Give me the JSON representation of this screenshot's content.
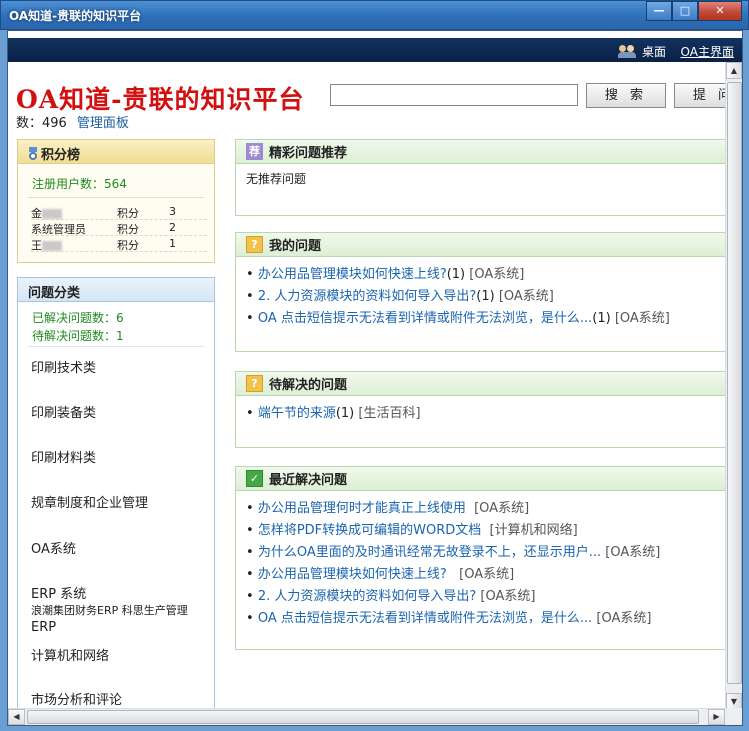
{
  "window": {
    "title": "OA知道-贵联的知识平台",
    "controls": {
      "minimize": "—",
      "maximize": "□",
      "close": "✕"
    }
  },
  "topbar": {
    "desktop": "桌面",
    "main": "OA主界面"
  },
  "header": {
    "site_title": "OA知道-贵联的知识平台",
    "search_value": "",
    "search_button": "搜 索",
    "ask_button": "提 问",
    "count_label": "数：496",
    "admin_link": "管理面板"
  },
  "score_board": {
    "title": "积分榜",
    "registered": "注册用户数：564",
    "rows": [
      {
        "name": "金",
        "label": "积分",
        "value": "3"
      },
      {
        "name": "系统管理员",
        "label": "积分",
        "value": "2"
      },
      {
        "name": "王",
        "label": "积分",
        "value": "1"
      }
    ]
  },
  "categories": {
    "title": "问题分类",
    "solved": "已解决问题数：6",
    "pending": "待解决问题数：1",
    "items": [
      "印刷技术类",
      "印刷装备类",
      "印刷材料类",
      "规章制度和企业管理",
      "OA系统",
      "ERP 系统",
      "浪潮集团财务ERP 科思生产管理",
      "ERP",
      "计算机和网络",
      "市场分析和评论"
    ]
  },
  "recommended": {
    "title": "精彩问题推荐",
    "empty": "无推荐问题",
    "icon": "荐"
  },
  "my_questions": {
    "title": "我的问题",
    "items": [
      {
        "text": "办公用品管理模块如何快速上线?",
        "count": "(1)",
        "tag": "[OA系统]"
      },
      {
        "text": "2. 人力资源模块的资料如何导入导出?",
        "count": "(1)",
        "tag": "[OA系统]"
      },
      {
        "text": "OA 点击短信提示无法看到详情或附件无法浏览，是什么...",
        "count": "(1)",
        "tag": "[OA系统]"
      }
    ]
  },
  "pending_questions": {
    "title": "待解决的问题",
    "items": [
      {
        "text": "端午节的来源",
        "count": "(1)",
        "tag": "[生活百科]"
      }
    ]
  },
  "recent_solved": {
    "title": "最近解决问题",
    "items": [
      {
        "text": "办公用品管理何时才能真正上线使用",
        "tag": "[OA系统]"
      },
      {
        "text": "怎样将PDF转换成可编辑的WORD文档",
        "tag": "[计算机和网络]"
      },
      {
        "text": "为什么OA里面的及时通讯经常无故登录不上，还显示用户...",
        "tag": "[OA系统]"
      },
      {
        "text": "办公用品管理模块如何快速上线?",
        "tag": "[OA系统]"
      },
      {
        "text": "2. 人力资源模块的资料如何导入导出?",
        "tag": "[OA系统]"
      },
      {
        "text": "OA 点击短信提示无法看到详情或附件无法浏览，是什么...",
        "tag": "[OA系统]"
      }
    ]
  }
}
